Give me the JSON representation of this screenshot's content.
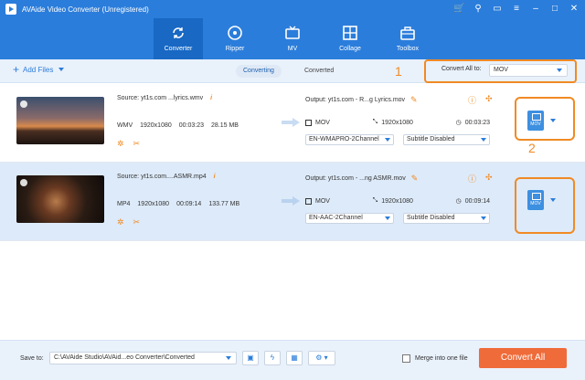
{
  "window": {
    "title": "AVAide Video Converter (Unregistered)",
    "icons": [
      "cart-icon",
      "user-icon",
      "chat-icon",
      "menu-icon",
      "minimize-icon",
      "maximize-icon",
      "close-icon"
    ]
  },
  "nav": {
    "items": [
      {
        "label": "Converter",
        "icon": "converter-icon",
        "active": true
      },
      {
        "label": "Ripper",
        "icon": "ripper-icon"
      },
      {
        "label": "MV",
        "icon": "mv-icon"
      },
      {
        "label": "Collage",
        "icon": "collage-icon"
      },
      {
        "label": "Toolbox",
        "icon": "toolbox-icon"
      }
    ]
  },
  "toolbar": {
    "add_files": "Add Files",
    "tabs": [
      "Converting",
      "Converted"
    ],
    "active_tab": "Converting",
    "convert_all_label": "Convert All to:",
    "convert_all_value": "MOV"
  },
  "annotations": {
    "one": "1",
    "two": "2"
  },
  "files": [
    {
      "source": "Source: yt1s.com ...lyrics.wmv",
      "format": "WMV",
      "resolution": "1920x1080",
      "duration": "00:03:23",
      "size": "28.15 MB",
      "output": "Output: yt1s.com - R...g Lyrics.mov",
      "out_format": "MOV",
      "out_resolution": "1920x1080",
      "out_duration": "00:03:23",
      "audio": "EN-WMAPRO-2Channel",
      "subtitle": "Subtitle Disabled",
      "format_badge": "MOV"
    },
    {
      "source": "Source: yt1s.com....ASMR.mp4",
      "format": "MP4",
      "resolution": "1920x1080",
      "duration": "00:09:14",
      "size": "133.77 MB",
      "output": "Output: yt1s.com - ...ng ASMR.mov",
      "out_format": "MOV",
      "out_resolution": "1920x1080",
      "out_duration": "00:09:14",
      "audio": "EN-AAC-2Channel",
      "subtitle": "Subtitle Disabled",
      "format_badge": "MOV"
    }
  ],
  "footer": {
    "save_label": "Save to:",
    "save_path": "C:\\AVAide Studio\\AVAid...eo Converter\\Converted",
    "merge_label": "Merge into one file",
    "convert_all_button": "Convert All"
  },
  "colors": {
    "brand": "#2b7ddb",
    "accent": "#f08a24",
    "convert": "#ef6b3a"
  }
}
